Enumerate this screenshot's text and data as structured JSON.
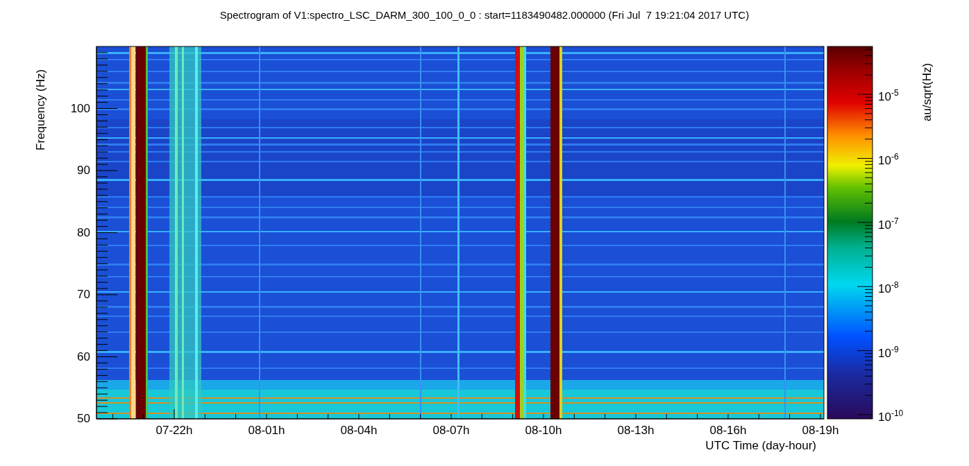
{
  "title": "Spectrogram of V1:spectro_LSC_DARM_300_100_0_0 : start=1183490482.000000 (Fri Jul  7 19:21:04 2017 UTC)",
  "plot": {
    "ylabel": "Frequency (Hz)",
    "xlabel": "UTC Time (day-hour)",
    "yticks": [
      "100",
      "90",
      "80",
      "70",
      "60",
      "50"
    ],
    "xticks": [
      "07-22h",
      "08-01h",
      "08-04h",
      "08-07h",
      "08-10h",
      "08-13h",
      "08-16h",
      "08-19h"
    ]
  },
  "colorbar": {
    "label": "au/sqrt(Hz)",
    "ticks": [
      "10$^{-5}$",
      "10$^{-6}$",
      "10$^{-7}$",
      "10$^{-8}$",
      "10$^{-9}$",
      "10$^{-10}$"
    ]
  }
}
